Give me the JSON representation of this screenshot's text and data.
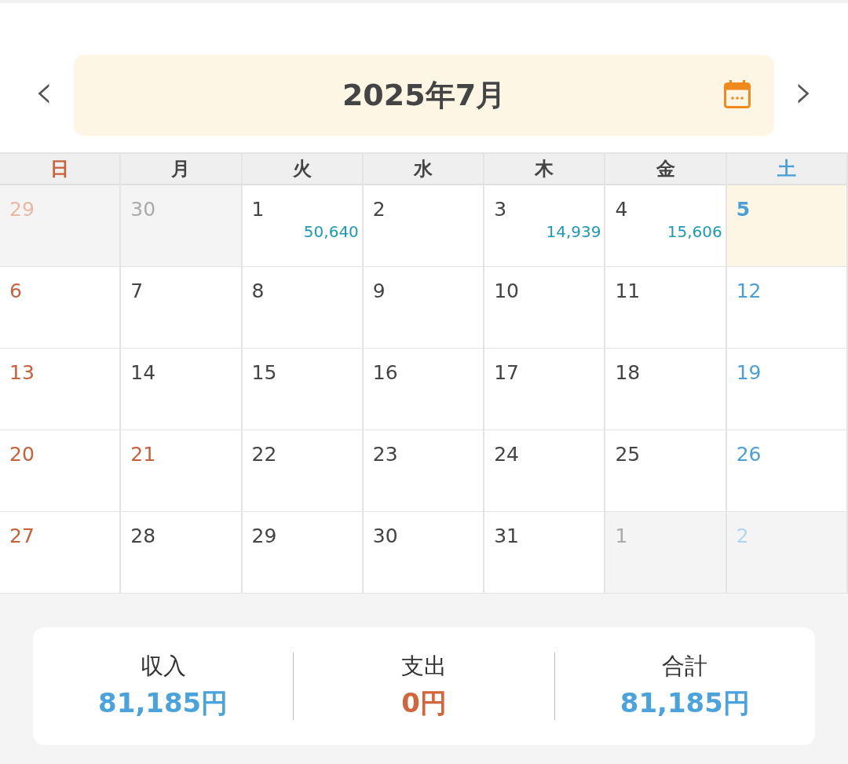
{
  "header": {
    "title": "2025年7月",
    "prev": "‹",
    "next": "›"
  },
  "weekdays": [
    {
      "label": "日",
      "kind": "sun"
    },
    {
      "label": "月",
      "kind": "weekday"
    },
    {
      "label": "火",
      "kind": "weekday"
    },
    {
      "label": "水",
      "kind": "weekday"
    },
    {
      "label": "木",
      "kind": "weekday"
    },
    {
      "label": "金",
      "kind": "weekday"
    },
    {
      "label": "土",
      "kind": "sat"
    }
  ],
  "weeks": [
    [
      {
        "day": "29",
        "in_month": false,
        "holiday": false,
        "selected": false
      },
      {
        "day": "30",
        "in_month": false,
        "holiday": false,
        "selected": false
      },
      {
        "day": "1",
        "in_month": true,
        "holiday": false,
        "selected": false,
        "amount": "50,640"
      },
      {
        "day": "2",
        "in_month": true,
        "holiday": false,
        "selected": false
      },
      {
        "day": "3",
        "in_month": true,
        "holiday": false,
        "selected": false,
        "amount": "14,939"
      },
      {
        "day": "4",
        "in_month": true,
        "holiday": false,
        "selected": false,
        "amount": "15,606"
      },
      {
        "day": "5",
        "in_month": true,
        "holiday": false,
        "selected": true
      }
    ],
    [
      {
        "day": "6",
        "in_month": true,
        "holiday": false,
        "selected": false
      },
      {
        "day": "7",
        "in_month": true,
        "holiday": false,
        "selected": false
      },
      {
        "day": "8",
        "in_month": true,
        "holiday": false,
        "selected": false
      },
      {
        "day": "9",
        "in_month": true,
        "holiday": false,
        "selected": false
      },
      {
        "day": "10",
        "in_month": true,
        "holiday": false,
        "selected": false
      },
      {
        "day": "11",
        "in_month": true,
        "holiday": false,
        "selected": false
      },
      {
        "day": "12",
        "in_month": true,
        "holiday": false,
        "selected": false
      }
    ],
    [
      {
        "day": "13",
        "in_month": true,
        "holiday": false,
        "selected": false
      },
      {
        "day": "14",
        "in_month": true,
        "holiday": false,
        "selected": false
      },
      {
        "day": "15",
        "in_month": true,
        "holiday": false,
        "selected": false
      },
      {
        "day": "16",
        "in_month": true,
        "holiday": false,
        "selected": false
      },
      {
        "day": "17",
        "in_month": true,
        "holiday": false,
        "selected": false
      },
      {
        "day": "18",
        "in_month": true,
        "holiday": false,
        "selected": false
      },
      {
        "day": "19",
        "in_month": true,
        "holiday": false,
        "selected": false
      }
    ],
    [
      {
        "day": "20",
        "in_month": true,
        "holiday": false,
        "selected": false
      },
      {
        "day": "21",
        "in_month": true,
        "holiday": true,
        "selected": false
      },
      {
        "day": "22",
        "in_month": true,
        "holiday": false,
        "selected": false
      },
      {
        "day": "23",
        "in_month": true,
        "holiday": false,
        "selected": false
      },
      {
        "day": "24",
        "in_month": true,
        "holiday": false,
        "selected": false
      },
      {
        "day": "25",
        "in_month": true,
        "holiday": false,
        "selected": false
      },
      {
        "day": "26",
        "in_month": true,
        "holiday": false,
        "selected": false
      }
    ],
    [
      {
        "day": "27",
        "in_month": true,
        "holiday": false,
        "selected": false
      },
      {
        "day": "28",
        "in_month": true,
        "holiday": false,
        "selected": false
      },
      {
        "day": "29",
        "in_month": true,
        "holiday": false,
        "selected": false
      },
      {
        "day": "30",
        "in_month": true,
        "holiday": false,
        "selected": false
      },
      {
        "day": "31",
        "in_month": true,
        "holiday": false,
        "selected": false
      },
      {
        "day": "1",
        "in_month": false,
        "holiday": false,
        "selected": false
      },
      {
        "day": "2",
        "in_month": false,
        "holiday": false,
        "selected": false
      }
    ]
  ],
  "summary": [
    {
      "label": "収入",
      "value": "81,185円",
      "kind": "income"
    },
    {
      "label": "支出",
      "value": "0円",
      "kind": "expense"
    },
    {
      "label": "合計",
      "value": "81,185円",
      "kind": "total"
    }
  ]
}
